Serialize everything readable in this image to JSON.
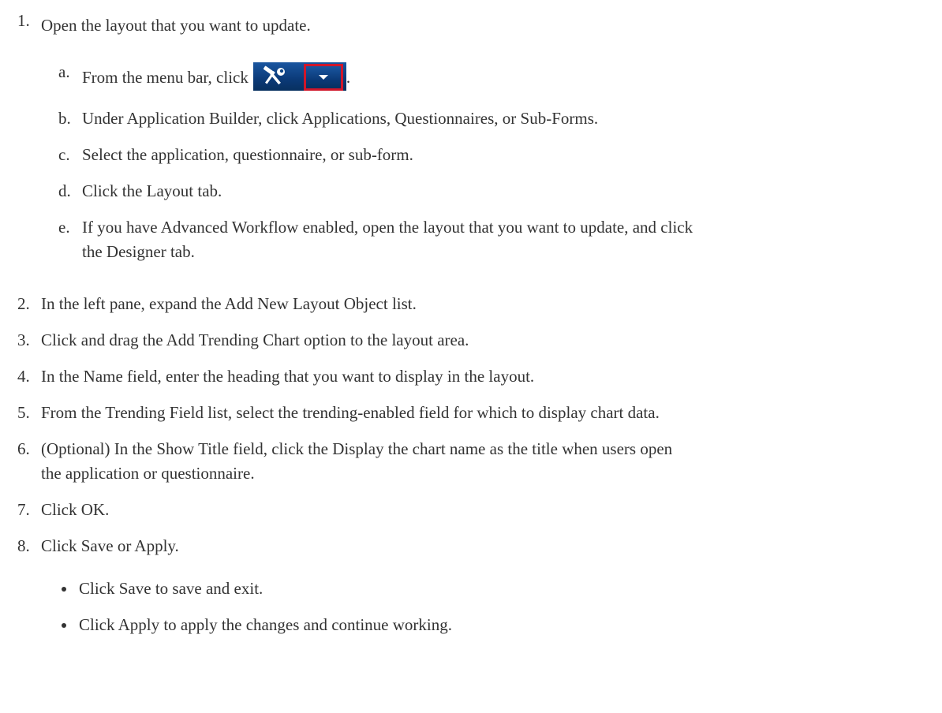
{
  "steps": [
    {
      "number": "1.",
      "text": "Open the layout that you want to update."
    },
    {
      "number": "2.",
      "text": "In the left pane, expand the Add New Layout Object list."
    },
    {
      "number": "3.",
      "text": "Click and drag the Add Trending Chart option to the layout area."
    },
    {
      "number": "4.",
      "text": "In the Name field, enter the heading that you want to display in the layout."
    },
    {
      "number": "5.",
      "text": "From the Trending Field list, select the trending-enabled field for which to display chart data."
    },
    {
      "number": "6.",
      "text": "(Optional) In the Show Title field, click the Display the chart name as the title when users open",
      "text_cont": "the application or questionnaire."
    },
    {
      "number": "7.",
      "text": "Click OK."
    },
    {
      "number": "8.",
      "text": "Click Save or Apply."
    }
  ],
  "substeps": [
    {
      "letter": "a.",
      "text": "From the menu bar, click",
      "suffix": "."
    },
    {
      "letter": "b.",
      "text": "Under Application Builder, click Applications, Questionnaires, or Sub-Forms."
    },
    {
      "letter": "c.",
      "text": "Select the application, questionnaire, or sub-form."
    },
    {
      "letter": "d.",
      "text": "Click the Layout tab."
    },
    {
      "letter": "e.",
      "text": "If you have Advanced Workflow enabled, open the layout that you want to update, and click",
      "text_cont": "the Designer tab."
    }
  ],
  "bullets": [
    {
      "text": "Click Save to save and exit."
    },
    {
      "text": "Click Apply to apply the changes and continue working."
    }
  ],
  "icons": {
    "tools": "tools-icon",
    "dropdown": "chevron-down-icon"
  },
  "colors": {
    "text": "#333333",
    "toolbar_bg": "#0b3a78",
    "highlight": "#d0162a"
  }
}
